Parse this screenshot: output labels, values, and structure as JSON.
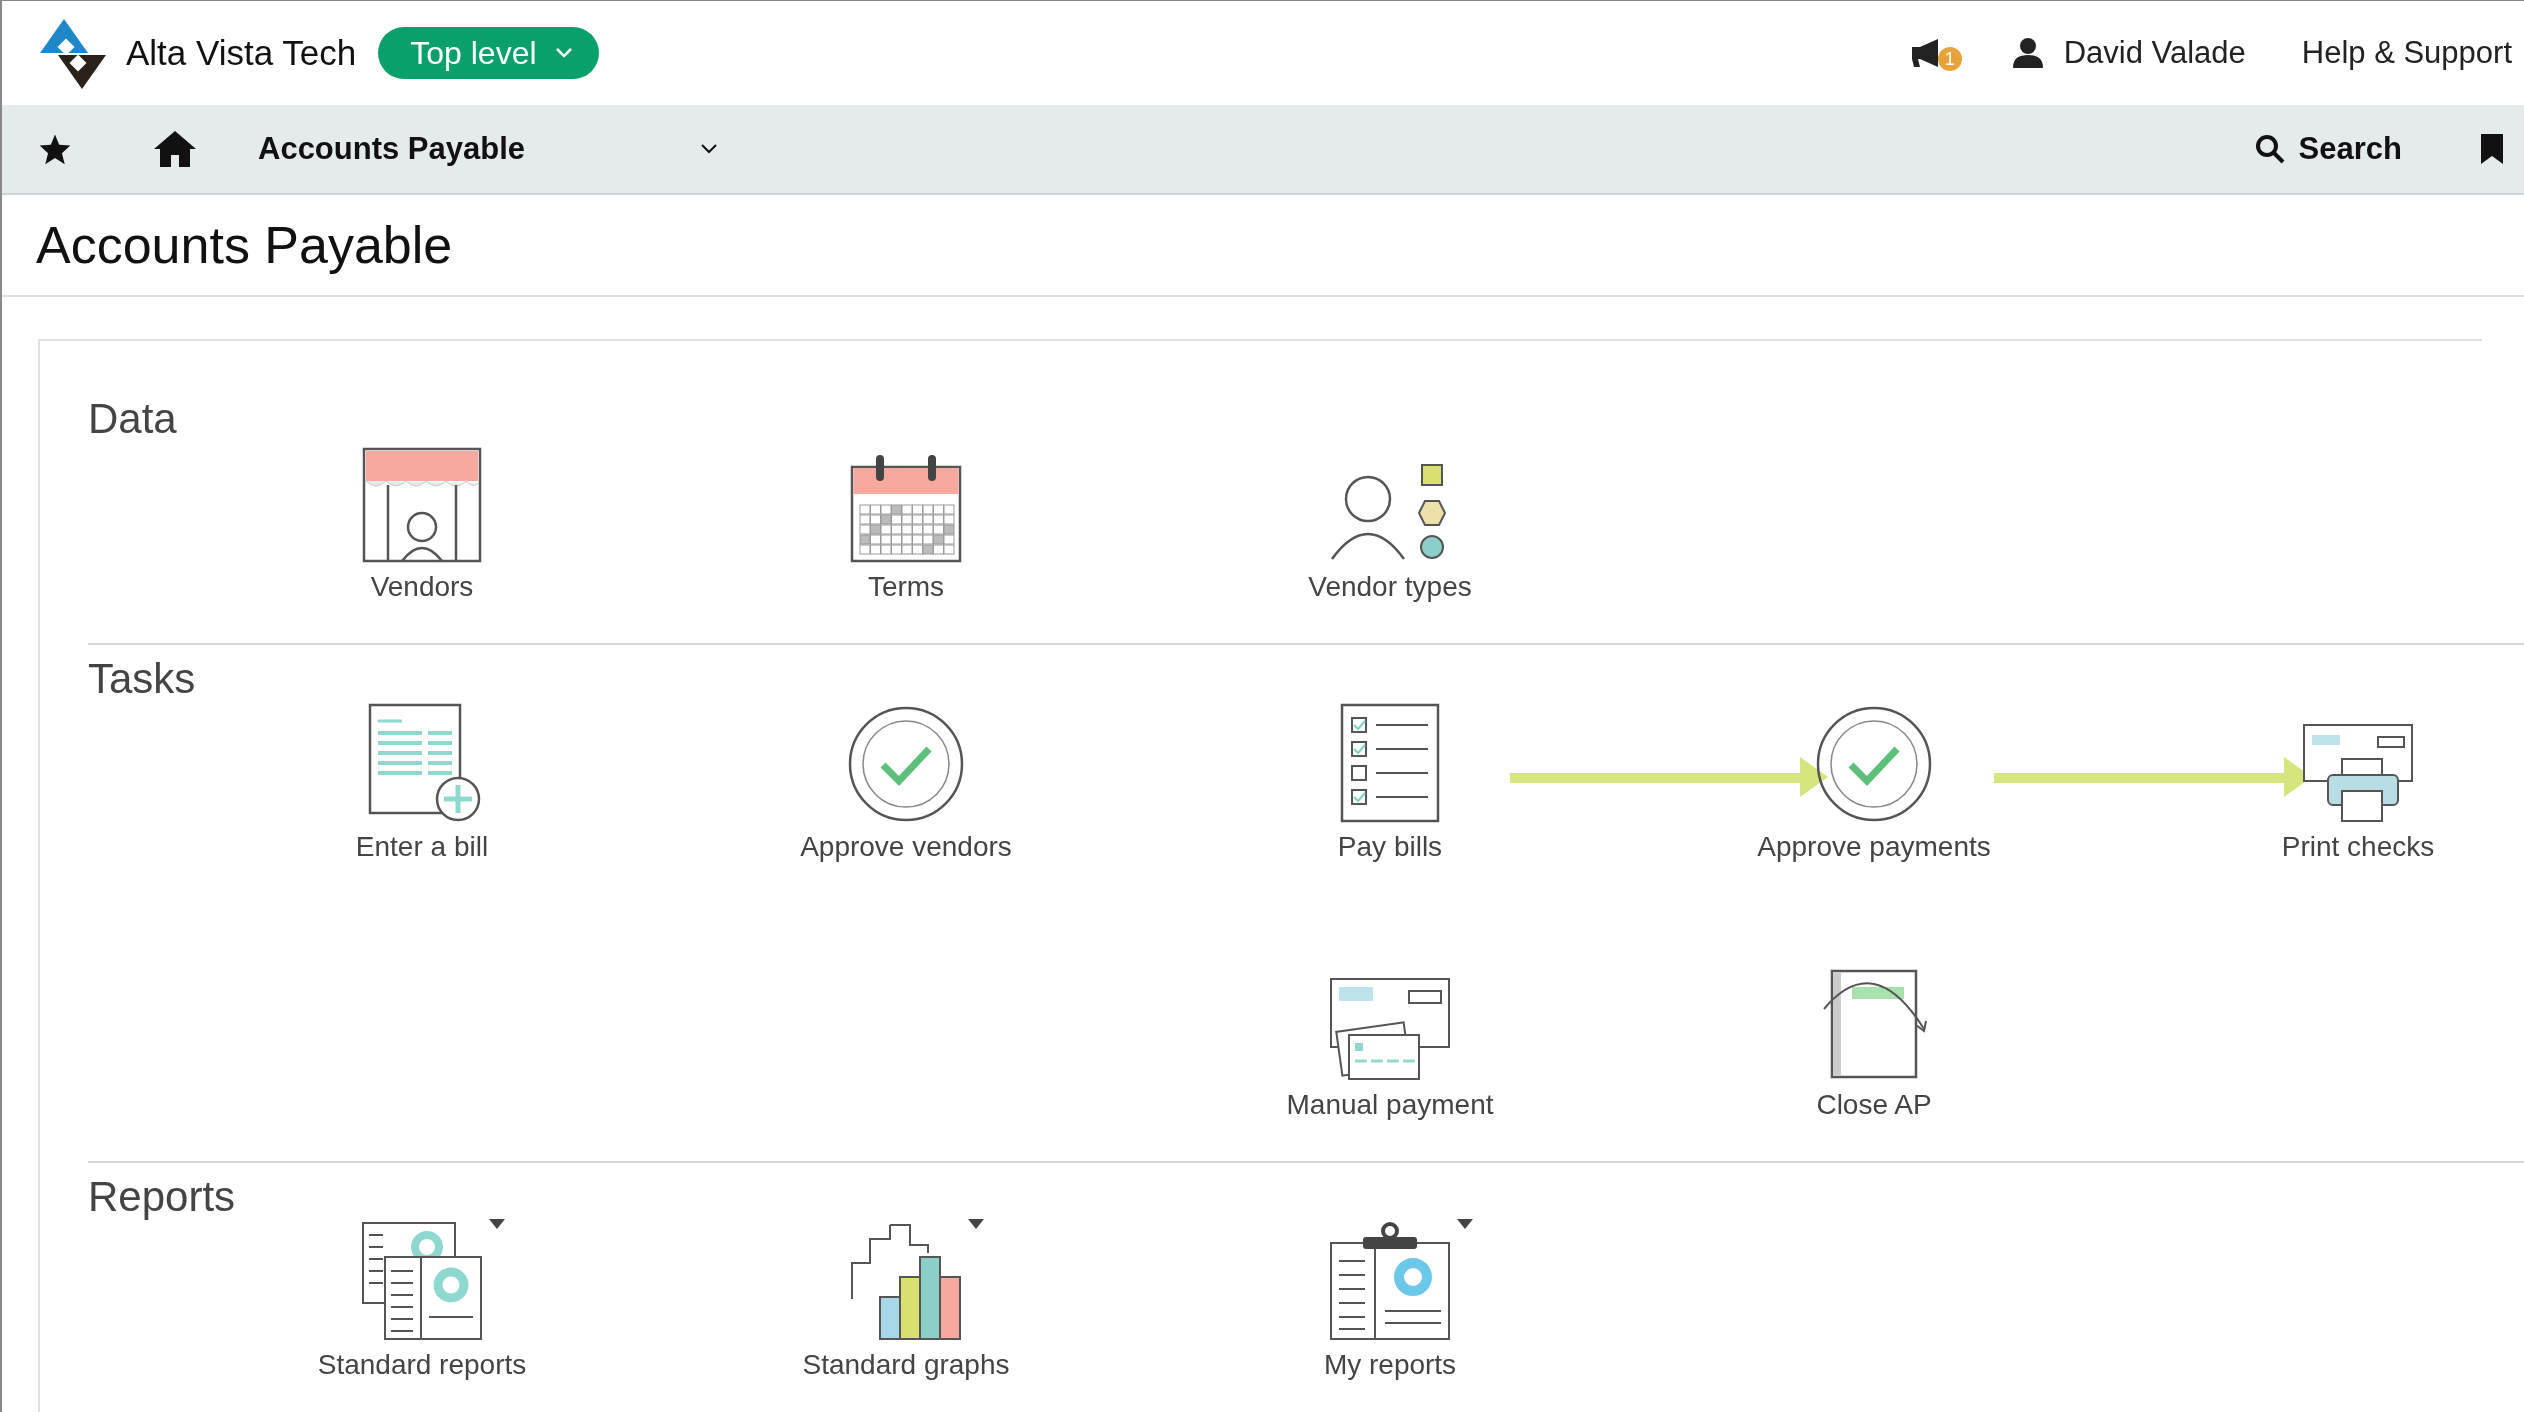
{
  "header": {
    "company": "Alta Vista Tech",
    "level_button": "Top level",
    "notification_count": "1",
    "user": "David Valade",
    "help": "Help & Support"
  },
  "nav": {
    "module": "Accounts Payable",
    "search": "Search"
  },
  "page_title": "Accounts Payable",
  "sections": [
    {
      "title": "Data",
      "rows": [
        [
          {
            "kind": "tile",
            "label": "Vendors"
          },
          {
            "kind": "tile",
            "label": "Terms"
          },
          {
            "kind": "tile",
            "label": "Vendor types"
          }
        ]
      ]
    },
    {
      "title": "Tasks",
      "rows": [
        [
          {
            "kind": "tile",
            "label": "Enter a bill"
          },
          {
            "kind": "tile",
            "label": "Approve vendors"
          },
          {
            "kind": "tile",
            "label": "Pay bills",
            "arrow": true
          },
          {
            "kind": "tile",
            "label": "Approve payments",
            "arrow": true
          },
          {
            "kind": "tile",
            "label": "Print checks"
          }
        ],
        [
          {
            "kind": "empty"
          },
          {
            "kind": "empty"
          },
          {
            "kind": "tile",
            "label": "Manual payment"
          },
          {
            "kind": "tile",
            "label": "Close AP"
          }
        ]
      ]
    },
    {
      "title": "Reports",
      "rows": [
        [
          {
            "kind": "tile",
            "label": "Standard reports",
            "menu": true
          },
          {
            "kind": "tile",
            "label": "Standard graphs",
            "menu": true
          },
          {
            "kind": "tile",
            "label": "My reports",
            "menu": true
          }
        ]
      ]
    }
  ]
}
